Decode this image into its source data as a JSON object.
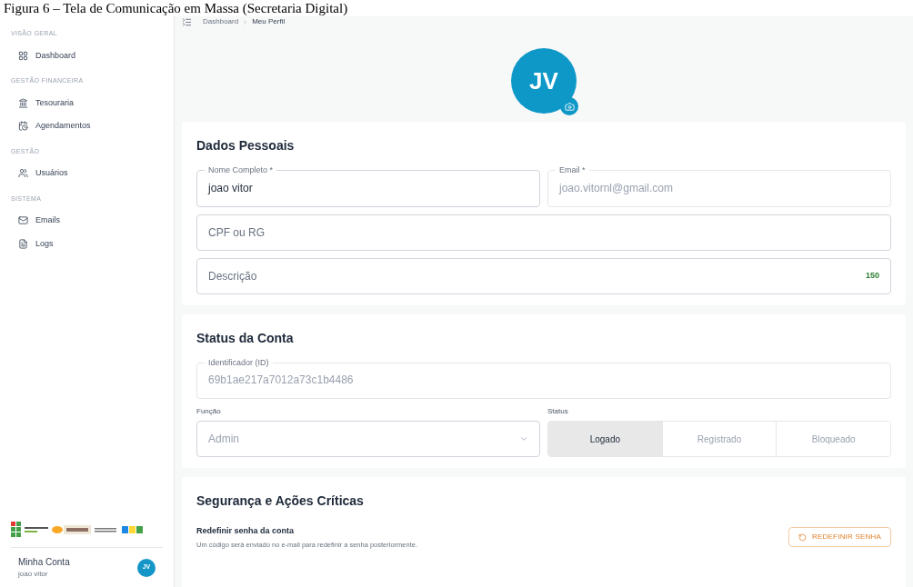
{
  "caption": "Figura 6 – Tela de Comunicação em Massa (Secretaria Digital)",
  "sidebar": {
    "sections": [
      {
        "title": "VISÃO GERAL",
        "items": [
          {
            "label": "Dashboard"
          }
        ]
      },
      {
        "title": "GESTÃO FINANCEIRA",
        "items": [
          {
            "label": "Tesouraria"
          },
          {
            "label": "Agendamentos"
          }
        ]
      },
      {
        "title": "GESTÃO",
        "items": [
          {
            "label": "Usuários"
          }
        ]
      },
      {
        "title": "SISTEMA",
        "items": [
          {
            "label": "Emails"
          },
          {
            "label": "Logs"
          }
        ]
      }
    ],
    "account": {
      "title": "Minha Conta",
      "name": "joao vitor",
      "initials": "JV"
    }
  },
  "breadcrumb": [
    "Dashboard",
    "Meu Perfil"
  ],
  "avatar": {
    "initials": "JV"
  },
  "personal": {
    "title": "Dados Pessoais",
    "fields": [
      {
        "label": "Nome Completo *",
        "value": "joao vitor",
        "disabled": false
      },
      {
        "label": "Email *",
        "value": "joao.vitornl@gmail.com",
        "disabled": true
      },
      {
        "placeholder": "CPF ou RG"
      },
      {
        "placeholder": "Descrição",
        "counter": "150"
      }
    ]
  },
  "status": {
    "title": "Status da Conta",
    "id_field": {
      "label": "Identificador (ID)",
      "value": "69b1ae217a7012a73c1b4486",
      "disabled": true
    },
    "role": {
      "label": "Função",
      "value": "Admin"
    },
    "status_label": "Status",
    "options": [
      {
        "label": "Logado",
        "selected": true
      },
      {
        "label": "Registrado",
        "selected": false
      },
      {
        "label": "Bloqueado",
        "selected": false
      }
    ]
  },
  "security": {
    "title": "Segurança e Ações Críticas",
    "action_title": "Redefinir senha da conta",
    "action_text": "Um código será enviado no e-mail para redefinir a senha posteriormente.",
    "button": "REDEFINIR SENHA"
  }
}
